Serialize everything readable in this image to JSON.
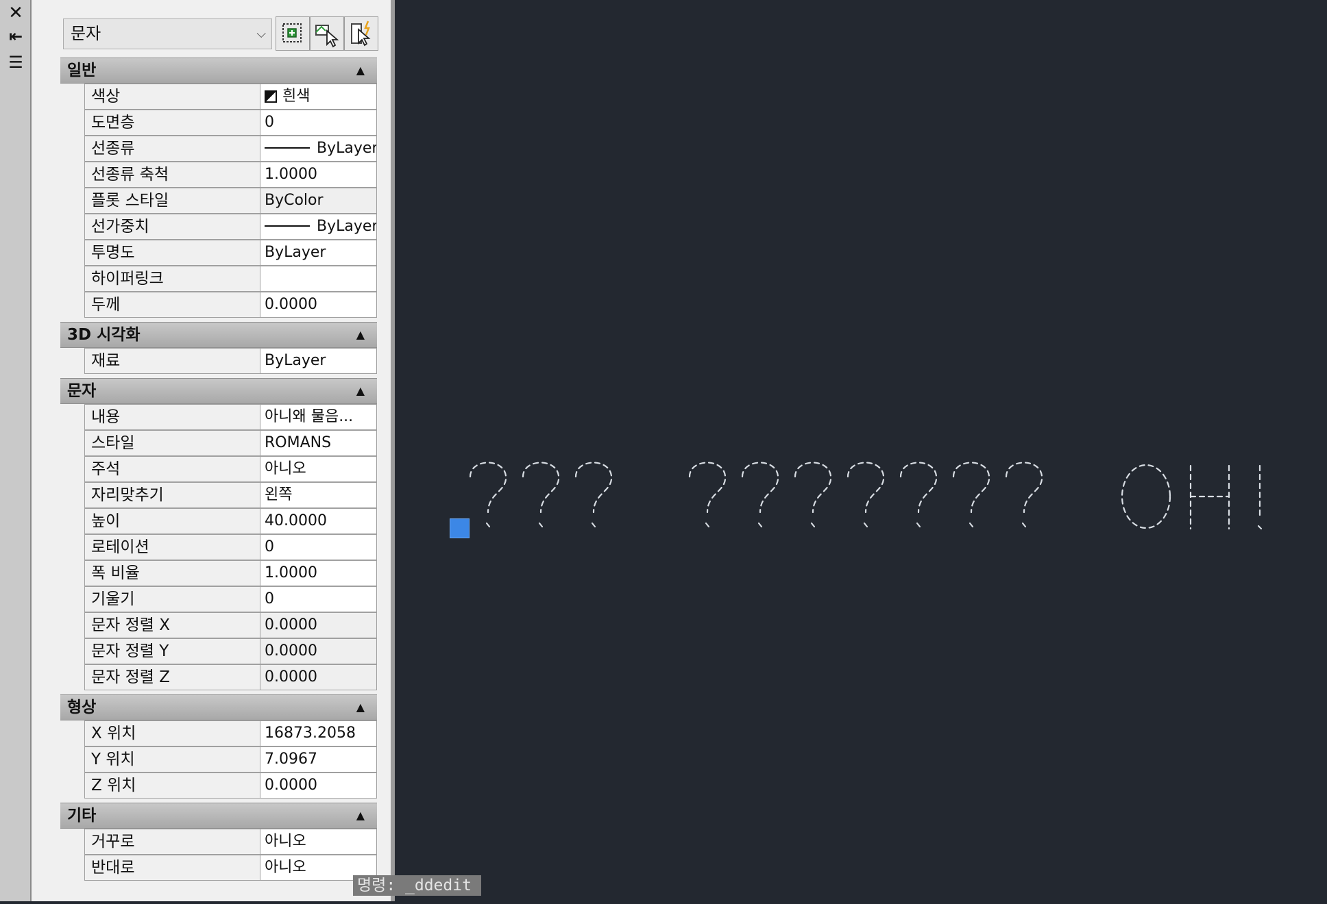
{
  "side_strip": {
    "buttons": [
      {
        "name": "close-icon",
        "glyph": "✕"
      },
      {
        "name": "auto-hide-icon",
        "glyph": "⇤"
      },
      {
        "name": "properties-menu-icon",
        "glyph": "☰"
      }
    ]
  },
  "panel": {
    "object_type": "문자",
    "toolbar": [
      {
        "name": "toggle-pickadd-icon"
      },
      {
        "name": "select-objects-icon"
      },
      {
        "name": "quick-select-icon"
      }
    ],
    "categories": [
      {
        "title": "일반",
        "rows": [
          {
            "label": "색상",
            "value": "흰색",
            "icon": "color-swatch-icon"
          },
          {
            "label": "도면층",
            "value": "0"
          },
          {
            "label": "선종류",
            "value": "ByLayer",
            "icon": "linetype-icon"
          },
          {
            "label": "선종류 축척",
            "value": "1.0000"
          },
          {
            "label": "플롯 스타일",
            "value": "ByColor",
            "gray": true
          },
          {
            "label": "선가중치",
            "value": "ByLayer",
            "icon": "lineweight-icon"
          },
          {
            "label": "투명도",
            "value": "ByLayer"
          },
          {
            "label": "하이퍼링크",
            "value": ""
          },
          {
            "label": "두께",
            "value": "0.0000"
          }
        ]
      },
      {
        "title": "3D 시각화",
        "rows": [
          {
            "label": "재료",
            "value": "ByLayer"
          }
        ]
      },
      {
        "title": "문자",
        "rows": [
          {
            "label": "내용",
            "value": "아니왜 물음..."
          },
          {
            "label": "스타일",
            "value": "ROMANS"
          },
          {
            "label": "주석",
            "value": "아니오"
          },
          {
            "label": "자리맞추기",
            "value": "왼쪽"
          },
          {
            "label": "높이",
            "value": "40.0000"
          },
          {
            "label": "로테이션",
            "value": "0"
          },
          {
            "label": "폭 비율",
            "value": "1.0000"
          },
          {
            "label": "기울기",
            "value": "0"
          },
          {
            "label": "문자 정렬 X",
            "value": "0.0000",
            "gray": true
          },
          {
            "label": "문자 정렬 Y",
            "value": "0.0000",
            "gray": true
          },
          {
            "label": "문자 정렬 Z",
            "value": "0.0000",
            "gray": true
          }
        ]
      },
      {
        "title": "형상",
        "rows": [
          {
            "label": "X 위치",
            "value": "16873.2058"
          },
          {
            "label": "Y 위치",
            "value": "7.0967"
          },
          {
            "label": "Z 위치",
            "value": "0.0000"
          }
        ]
      },
      {
        "title": "기타",
        "rows": [
          {
            "label": "거꾸로",
            "value": "아니오"
          },
          {
            "label": "반대로",
            "value": "아니오"
          }
        ]
      }
    ]
  },
  "canvas": {
    "text_groups": [
      "???",
      "???????",
      "OH!"
    ],
    "command_prompt": "명령: _ddedit"
  }
}
